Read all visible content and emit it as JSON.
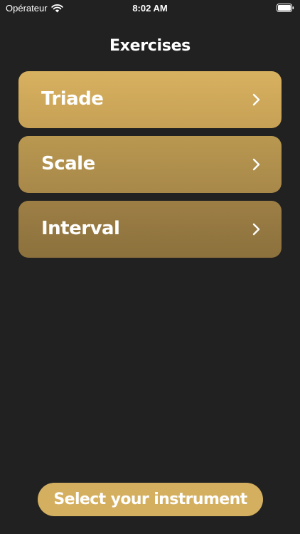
{
  "status_bar": {
    "carrier": "Opérateur",
    "time": "8:02 AM",
    "wifi_icon": "wifi-icon",
    "battery_icon": "battery-icon"
  },
  "header": {
    "title": "Exercises"
  },
  "exercises": [
    {
      "label": "Triade",
      "icon": "chevron-right-icon"
    },
    {
      "label": "Scale",
      "icon": "chevron-right-icon"
    },
    {
      "label": "Interval",
      "icon": "chevron-right-icon"
    }
  ],
  "footer": {
    "select_instrument_label": "Select your instrument"
  },
  "colors": {
    "background": "#212121",
    "accent": "#d4af5f",
    "text": "#ffffff"
  }
}
